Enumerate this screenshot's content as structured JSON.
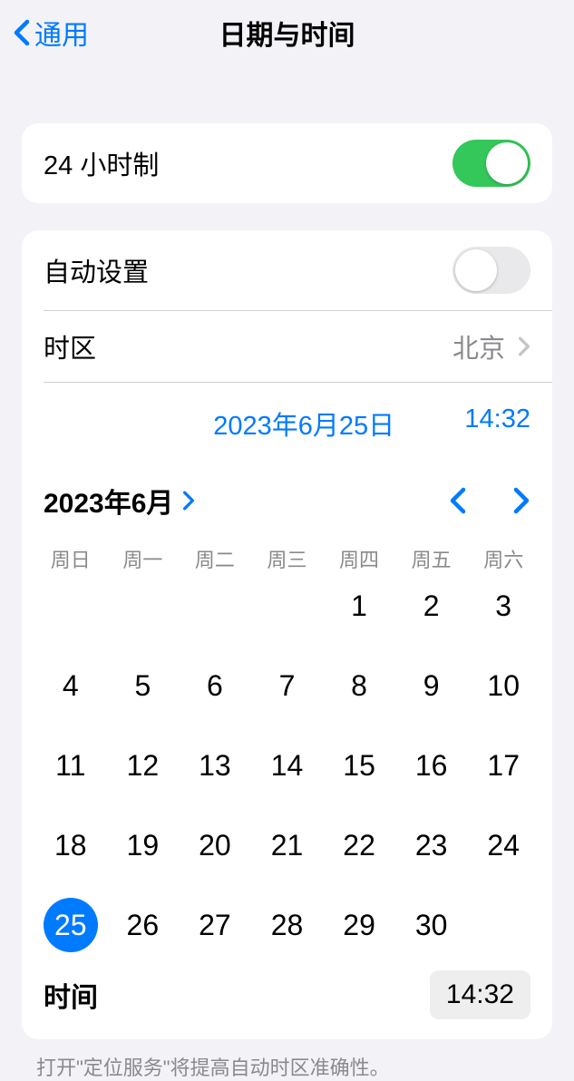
{
  "nav": {
    "back_label": "通用",
    "title": "日期与时间"
  },
  "settings": {
    "hour24_label": "24 小时制",
    "hour24_on": true,
    "auto_label": "自动设置",
    "auto_on": false,
    "timezone_label": "时区",
    "timezone_value": "北京"
  },
  "datetime": {
    "date_display": "2023年6月25日",
    "time_display": "14:32",
    "month_header": "2023年6月",
    "weekdays": [
      "周日",
      "周一",
      "周二",
      "周三",
      "周四",
      "周五",
      "周六"
    ],
    "leading_blanks": 4,
    "days_in_month": 30,
    "selected_day": 25,
    "time_label": "时间",
    "time_value": "14:32"
  },
  "footer": {
    "note": "打开\"定位服务\"将提高自动时区准确性。"
  }
}
